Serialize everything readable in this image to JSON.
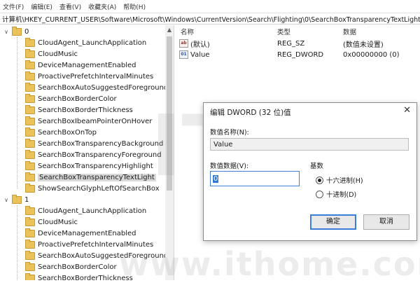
{
  "menu": [
    "文件(F)",
    "编辑(E)",
    "查看(V)",
    "收藏夹(A)",
    "帮助(H)"
  ],
  "address": "计算机\\HKEY_CURRENT_USER\\Software\\Microsoft\\Windows\\CurrentVersion\\Search\\Flighting\\0\\SearchBoxTransparencyTextLight",
  "tree": {
    "group0": "0",
    "group0_items": [
      "CloudAgent_LaunchApplication",
      "CloudMusic",
      "DeviceManagementEnabled",
      "ProactivePrefetchIntervalMinutes",
      "SearchBoxAutoSuggestedForegroundCo",
      "SearchBoxBorderColor",
      "SearchBoxBorderThickness",
      "SearchBoxIbeamPointerOnHover",
      "SearchBoxOnTop",
      "SearchBoxTransparencyBackground",
      "SearchBoxTransparencyForeground",
      "SearchBoxTransparencyHighlight",
      "SearchBoxTransparencyTextLight",
      "ShowSearchGlyphLeftOfSearchBox"
    ],
    "group1": "1",
    "group1_items": [
      "CloudAgent_LaunchApplication",
      "CloudMusic",
      "DeviceManagementEnabled",
      "ProactivePrefetchIntervalMinutes",
      "SearchBoxAutoSuggestedForegroundCo",
      "SearchBoxBorderColor",
      "SearchBoxBorderThickness"
    ],
    "selected": "SearchBoxTransparencyTextLight"
  },
  "list": {
    "headers": {
      "name": "名称",
      "type": "类型",
      "data": "数据"
    },
    "rows": [
      {
        "name": "(默认)",
        "type": "REG_SZ",
        "data": "(数值未设置)",
        "icon": "string-value-icon"
      },
      {
        "name": "Value",
        "type": "REG_DWORD",
        "data": "0x00000000 (0)",
        "icon": "dword-value-icon"
      }
    ]
  },
  "dialog": {
    "title": "编辑 DWORD (32 位)值",
    "close": "✕",
    "name_label": "数值名称(N):",
    "name_value": "Value",
    "data_label": "数值数据(V):",
    "data_value": "0",
    "base_label": "基数",
    "radio_hex": "十六进制(H)",
    "radio_dec": "十进制(D)",
    "ok": "确定",
    "cancel": "取消"
  },
  "watermark": {
    "text": "www.ithome.com"
  },
  "colors": {
    "folder": "#e9c25a",
    "selection": "#3178d6",
    "focus_border": "#3b7dd8"
  }
}
